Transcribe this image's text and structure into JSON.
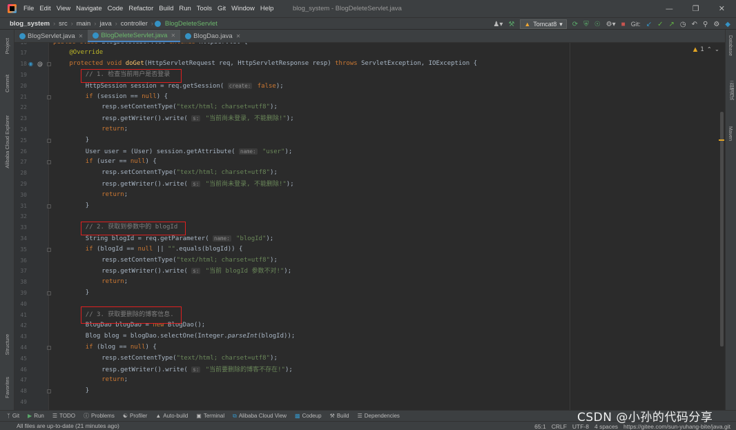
{
  "menubar": {
    "items": [
      "File",
      "Edit",
      "View",
      "Navigate",
      "Code",
      "Refactor",
      "Build",
      "Run",
      "Tools",
      "Git",
      "Window",
      "Help"
    ],
    "window_title": "blog_system - BlogDeleteServlet.java"
  },
  "navbar": {
    "breadcrumbs": [
      "blog_system",
      "src",
      "main",
      "java",
      "controller",
      "BlogDeleteServlet"
    ],
    "run_config": "Tomcat8",
    "git_label": "Git:"
  },
  "tabs": [
    {
      "label": "BlogServlet.java",
      "active": false
    },
    {
      "label": "BlogDeleteServlet.java",
      "active": true
    },
    {
      "label": "BlogDao.java",
      "active": false
    }
  ],
  "left_tools": [
    "Project",
    "Commit",
    "Alibaba Cloud Explorer",
    "Structure",
    "Favorites"
  ],
  "right_tools": [
    "Database",
    "云端调试",
    "Maven"
  ],
  "warning_indicator": "1",
  "code": {
    "lines": [
      {
        "n": "16",
        "text": "public class BlogDeleteServlet extends HttpServlet {"
      },
      {
        "n": "17",
        "text": "@Override"
      },
      {
        "n": "18",
        "text": "protected void doGet(HttpServletRequest req, HttpServletResponse resp) throws ServletException, IOException {"
      },
      {
        "n": "19",
        "text": "// 1. 检查当前用户是否登录"
      },
      {
        "n": "20",
        "text": "HttpSession session = req.getSession( create: false);"
      },
      {
        "n": "21",
        "text": "if (session == null) {"
      },
      {
        "n": "22",
        "text": "resp.setContentType(\"text/html; charset=utf8\");"
      },
      {
        "n": "23",
        "text": "resp.getWriter().write( s: \"当前尚未登录, 不能删除!\");"
      },
      {
        "n": "24",
        "text": "return;"
      },
      {
        "n": "25",
        "text": "}"
      },
      {
        "n": "26",
        "text": "User user = (User) session.getAttribute( name: \"user\");"
      },
      {
        "n": "27",
        "text": "if (user == null) {"
      },
      {
        "n": "28",
        "text": "resp.setContentType(\"text/html; charset=utf8\");"
      },
      {
        "n": "29",
        "text": "resp.getWriter().write( s: \"当前尚未登录, 不能删除!\");"
      },
      {
        "n": "30",
        "text": "return;"
      },
      {
        "n": "31",
        "text": "}"
      },
      {
        "n": "32",
        "text": ""
      },
      {
        "n": "33",
        "text": "// 2. 获取到参数中的 blogId"
      },
      {
        "n": "34",
        "text": "String blogId = req.getParameter( name: \"blogId\");"
      },
      {
        "n": "35",
        "text": "if (blogId == null || \"\".equals(blogId)) {"
      },
      {
        "n": "36",
        "text": "resp.setContentType(\"text/html; charset=utf8\");"
      },
      {
        "n": "37",
        "text": "resp.getWriter().write( s: \"当前 blogId 参数不对!\");"
      },
      {
        "n": "38",
        "text": "return;"
      },
      {
        "n": "39",
        "text": "}"
      },
      {
        "n": "40",
        "text": ""
      },
      {
        "n": "41",
        "text": "// 3. 获取要删除的博客信息."
      },
      {
        "n": "42",
        "text": "BlogDao blogDao = new BlogDao();"
      },
      {
        "n": "43",
        "text": "Blog blog = blogDao.selectOne(Integer.parseInt(blogId));"
      },
      {
        "n": "44",
        "text": "if (blog == null) {"
      },
      {
        "n": "45",
        "text": "resp.setContentType(\"text/html; charset=utf8\");"
      },
      {
        "n": "46",
        "text": "resp.getWriter().write( s: \"当前要删除的博客不存在!\");"
      },
      {
        "n": "47",
        "text": "return;"
      },
      {
        "n": "48",
        "text": "}"
      },
      {
        "n": "49",
        "text": ""
      }
    ]
  },
  "bottom_tools": [
    "Git",
    "Run",
    "TODO",
    "Problems",
    "Profiler",
    "Auto-build",
    "Terminal",
    "Alibaba Cloud View",
    "Codeup",
    "Build",
    "Dependencies"
  ],
  "status": {
    "message": "All files are up-to-date (21 minutes ago)",
    "position": "65:1",
    "line_sep": "CRLF",
    "encoding": "UTF-8",
    "indent": "4 spaces",
    "repo": "https://gitee.com/sun-yuhang-bite/java.git"
  },
  "watermark": "CSDN @小孙的代码分享"
}
